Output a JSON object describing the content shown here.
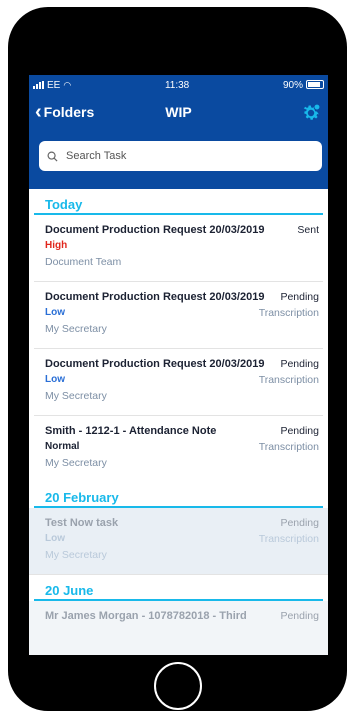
{
  "status_bar": {
    "carrier": "EE",
    "time": "11:38",
    "battery": "90%"
  },
  "nav": {
    "back_label": "Folders",
    "title": "WIP"
  },
  "search": {
    "placeholder": "Search Task"
  },
  "sections": [
    {
      "label": "Today"
    },
    {
      "label": "20 February"
    },
    {
      "label": "20 June"
    }
  ],
  "tasks": [
    {
      "title": "Document Production Request 20/03/2019",
      "status": "Sent",
      "priority": "High",
      "priority_color": "#e1261c",
      "workflow": "",
      "team": "Document Team"
    },
    {
      "title": "Document Production Request 20/03/2019",
      "status": "Pending",
      "priority": "Low",
      "priority_color": "#2a6fd6",
      "workflow": "Transcription",
      "team": "My Secretary"
    },
    {
      "title": "Document Production Request 20/03/2019",
      "status": "Pending",
      "priority": "Low",
      "priority_color": "#2a6fd6",
      "workflow": "Transcription",
      "team": "My Secretary"
    },
    {
      "title": "Smith - 1212-1 - Attendance Note",
      "status": "Pending",
      "priority": "Normal",
      "priority_color": "#1c2233",
      "workflow": "Transcription",
      "team": "My Secretary"
    },
    {
      "title": "Test Now task",
      "status": "Pending",
      "priority": "Low",
      "priority_color": "#b9c9da",
      "workflow": "Transcription",
      "team": "My Secretary"
    },
    {
      "title": "Mr James Morgan - 1078782018 - Third",
      "status": "Pending",
      "priority": "",
      "priority_color": "#b9c9da",
      "workflow": "",
      "team": ""
    }
  ],
  "colors": {
    "navbar": "#0a4aa0",
    "accent": "#18b9ea",
    "high": "#e1261c",
    "low": "#2a6fd6",
    "muted": "#7d8fa5"
  }
}
